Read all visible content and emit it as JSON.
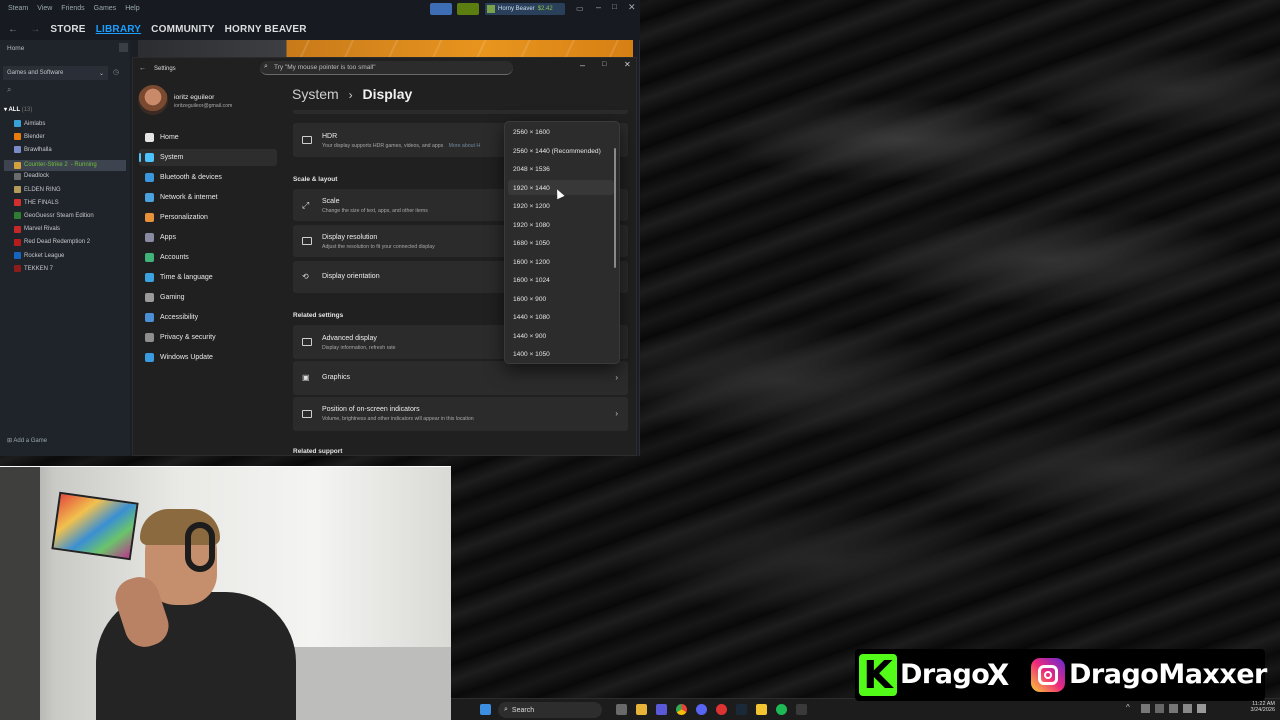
{
  "steam": {
    "menu": [
      "Steam",
      "View",
      "Friends",
      "Games",
      "Help"
    ],
    "nav": [
      "STORE",
      "LIBRARY",
      "COMMUNITY",
      "HORNY BEAVER"
    ],
    "user": {
      "name": "Horny Beaver",
      "balance": "$2.42"
    },
    "home_label": "Home",
    "filter_label": "Games and Software",
    "all_label": "ALL",
    "all_count": "(13)",
    "games": [
      {
        "name": "Aimlabs",
        "color": "#3aa0d8"
      },
      {
        "name": "Blender",
        "color": "#e87d0d"
      },
      {
        "name": "Brawlhalla",
        "color": "#7a8cc7"
      },
      {
        "name": "Counter-Strike 2",
        "status": " - Running",
        "color": "#d6a23b"
      },
      {
        "name": "Deadlock",
        "color": "#6b6b6b"
      },
      {
        "name": "ELDEN RING",
        "color": "#b59b5a"
      },
      {
        "name": "THE FINALS",
        "color": "#d32f2f"
      },
      {
        "name": "GeoGuessr Steam Edition",
        "color": "#2e7d32"
      },
      {
        "name": "Marvel Rivals",
        "color": "#c62828"
      },
      {
        "name": "Red Dead Redemption 2",
        "color": "#b71c1c"
      },
      {
        "name": "Rocket League",
        "color": "#1565c0"
      },
      {
        "name": "TEKKEN 7",
        "color": "#8e1b1b"
      }
    ],
    "add_game": "Add a Game"
  },
  "settings": {
    "window_title": "Settings",
    "search_placeholder": "Try \"My mouse pointer is too small\"",
    "account": {
      "name": "ioritz eguileor",
      "email": "ioritzeguileor@gmail.com"
    },
    "nav": [
      {
        "label": "Home",
        "color": "#e5e5e5"
      },
      {
        "label": "System",
        "color": "#4cc2ff"
      },
      {
        "label": "Bluetooth & devices",
        "color": "#3a96dd"
      },
      {
        "label": "Network & internet",
        "color": "#4aa3df"
      },
      {
        "label": "Personalization",
        "color": "#e8913b"
      },
      {
        "label": "Apps",
        "color": "#8a8aa3"
      },
      {
        "label": "Accounts",
        "color": "#40b37b"
      },
      {
        "label": "Time & language",
        "color": "#3aa3e0"
      },
      {
        "label": "Gaming",
        "color": "#9a9a9a"
      },
      {
        "label": "Accessibility",
        "color": "#4b8fd6"
      },
      {
        "label": "Privacy & security",
        "color": "#8e8e8e"
      },
      {
        "label": "Windows Update",
        "color": "#3a9be0"
      }
    ],
    "breadcrumb": {
      "parent": "System",
      "sep": "›",
      "current": "Display"
    },
    "hdr": {
      "title": "HDR",
      "subtitle": "Your display supports HDR games, videos, and apps",
      "more": "More about H"
    },
    "scale_layout_header": "Scale & layout",
    "scale": {
      "title": "Scale",
      "subtitle": "Change the size of text, apps, and other items"
    },
    "resolution": {
      "title": "Display resolution",
      "subtitle": "Adjust the resolution to fit your connected display"
    },
    "orientation": {
      "title": "Display orientation"
    },
    "related_header": "Related settings",
    "advanced": {
      "title": "Advanced display",
      "subtitle": "Display information, refresh rate"
    },
    "graphics": {
      "title": "Graphics"
    },
    "indicators": {
      "title": "Position of on-screen indicators",
      "subtitle": "Volume, brightness and other indicators will appear in this location"
    },
    "related_support": "Related support",
    "resolution_options": [
      "2560 × 1600",
      "2560 × 1440 (Recommended)",
      "2048 × 1536",
      "1920 × 1440",
      "1920 × 1200",
      "1920 × 1080",
      "1680 × 1050",
      "1600 × 1200",
      "1600 × 1024",
      "1600 × 900",
      "1440 × 1080",
      "1440 × 900",
      "1400 × 1050"
    ]
  },
  "taskbar": {
    "search_label": "Search",
    "time": "11:22 AM",
    "date": "3/24/2026"
  },
  "social": {
    "kick_name": "Drago",
    "sep": "X",
    "ig_name": "DragoMaxxer"
  }
}
